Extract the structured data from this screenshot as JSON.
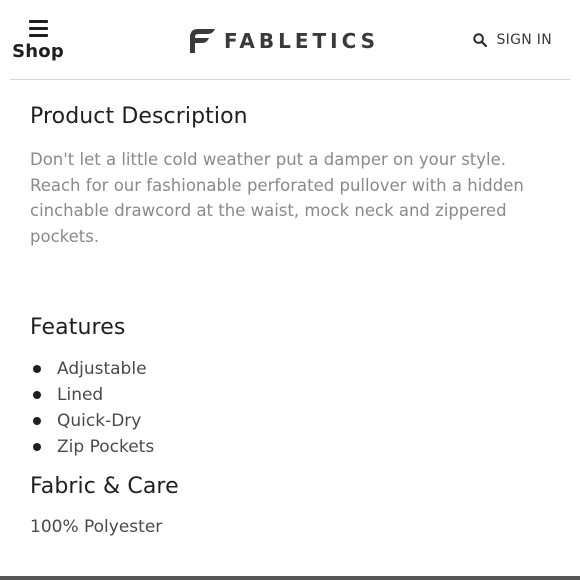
{
  "header": {
    "menu_label": "Shop",
    "brand_name": "FABLETICS",
    "signin_label": "SIGN IN"
  },
  "product_description": {
    "title": "Product Description",
    "text": "Don't let a little cold weather put a damper on your style. Reach for our fashionable perforated pullover with a hidden cinchable drawcord at the waist, mock neck and zippered pockets."
  },
  "features": {
    "title": "Features",
    "items": [
      "Adjustable",
      "Lined",
      "Quick-Dry",
      "Zip Pockets"
    ]
  },
  "fabric_care": {
    "title": "Fabric & Care",
    "text": "100% Polyester"
  },
  "icons": {
    "menu": "hamburger-icon",
    "brand": "fabletics-logo-icon",
    "search": "search-icon",
    "bullet": "bullet-icon"
  },
  "colors": {
    "text_dark": "#1f1f1f",
    "text_muted": "#8a8a8a",
    "divider": "#d6d6d6"
  }
}
